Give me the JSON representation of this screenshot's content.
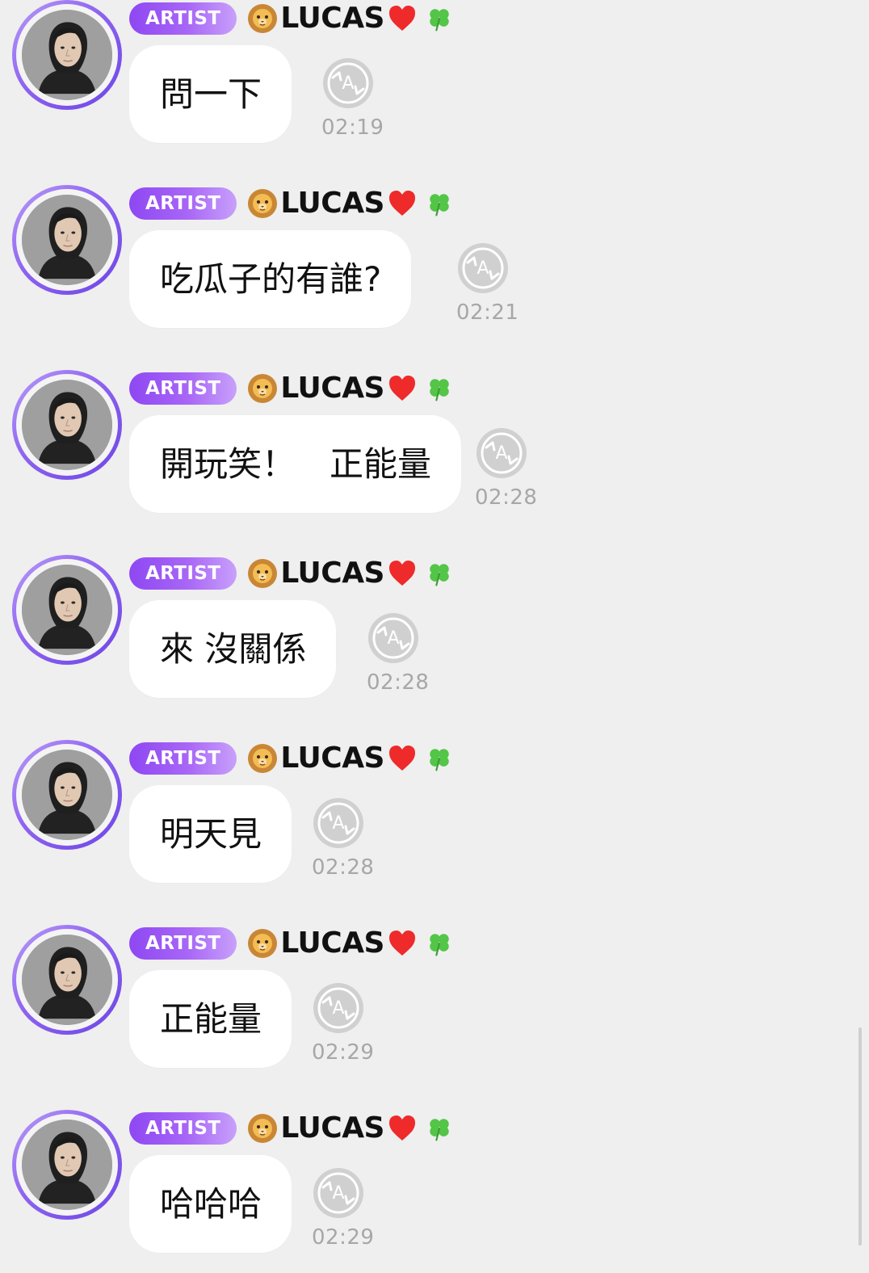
{
  "chat": {
    "messages": [
      {
        "badge": "ARTIST",
        "sender": "LUCAS",
        "text": "問一下",
        "time": "02:19",
        "avatar": "avatar-photo",
        "emoji_before": "lion-face-icon",
        "emoji_after": [
          "red-heart-icon",
          "four-leaf-clover-icon"
        ],
        "action_icon": "auto-translate-icon"
      },
      {
        "badge": "ARTIST",
        "sender": "LUCAS",
        "text": "吃瓜子的有誰?",
        "time": "02:21",
        "avatar": "avatar-photo",
        "emoji_before": "lion-face-icon",
        "emoji_after": [
          "red-heart-icon",
          "four-leaf-clover-icon"
        ],
        "action_icon": "auto-translate-icon"
      },
      {
        "badge": "ARTIST",
        "sender": "LUCAS",
        "text": "開玩笑！　正能量",
        "time": "02:28",
        "avatar": "avatar-photo",
        "emoji_before": "lion-face-icon",
        "emoji_after": [
          "red-heart-icon",
          "four-leaf-clover-icon"
        ],
        "action_icon": "auto-translate-icon"
      },
      {
        "badge": "ARTIST",
        "sender": "LUCAS",
        "text": "來 沒關係",
        "time": "02:28",
        "avatar": "avatar-photo",
        "emoji_before": "lion-face-icon",
        "emoji_after": [
          "red-heart-icon",
          "four-leaf-clover-icon"
        ],
        "action_icon": "auto-translate-icon"
      },
      {
        "badge": "ARTIST",
        "sender": "LUCAS",
        "text": "明天見",
        "time": "02:28",
        "avatar": "avatar-photo",
        "emoji_before": "lion-face-icon",
        "emoji_after": [
          "red-heart-icon",
          "four-leaf-clover-icon"
        ],
        "action_icon": "auto-translate-icon"
      },
      {
        "badge": "ARTIST",
        "sender": "LUCAS",
        "text": "正能量",
        "time": "02:29",
        "avatar": "avatar-photo",
        "emoji_before": "lion-face-icon",
        "emoji_after": [
          "red-heart-icon",
          "four-leaf-clover-icon"
        ],
        "action_icon": "auto-translate-icon"
      },
      {
        "badge": "ARTIST",
        "sender": "LUCAS",
        "text": "哈哈哈",
        "time": "02:29",
        "avatar": "avatar-photo",
        "emoji_before": "lion-face-icon",
        "emoji_after": [
          "red-heart-icon",
          "four-leaf-clover-icon"
        ],
        "action_icon": "auto-translate-icon"
      }
    ]
  },
  "colors": {
    "background": "#efefef",
    "bubble": "#ffffff",
    "badge_gradient_start": "#8e47f3",
    "badge_gradient_end": "#c8a0fb",
    "avatar_ring": "#8e63f0",
    "time_text": "#a7a7a7",
    "translate_icon": "#d0d0d0"
  }
}
